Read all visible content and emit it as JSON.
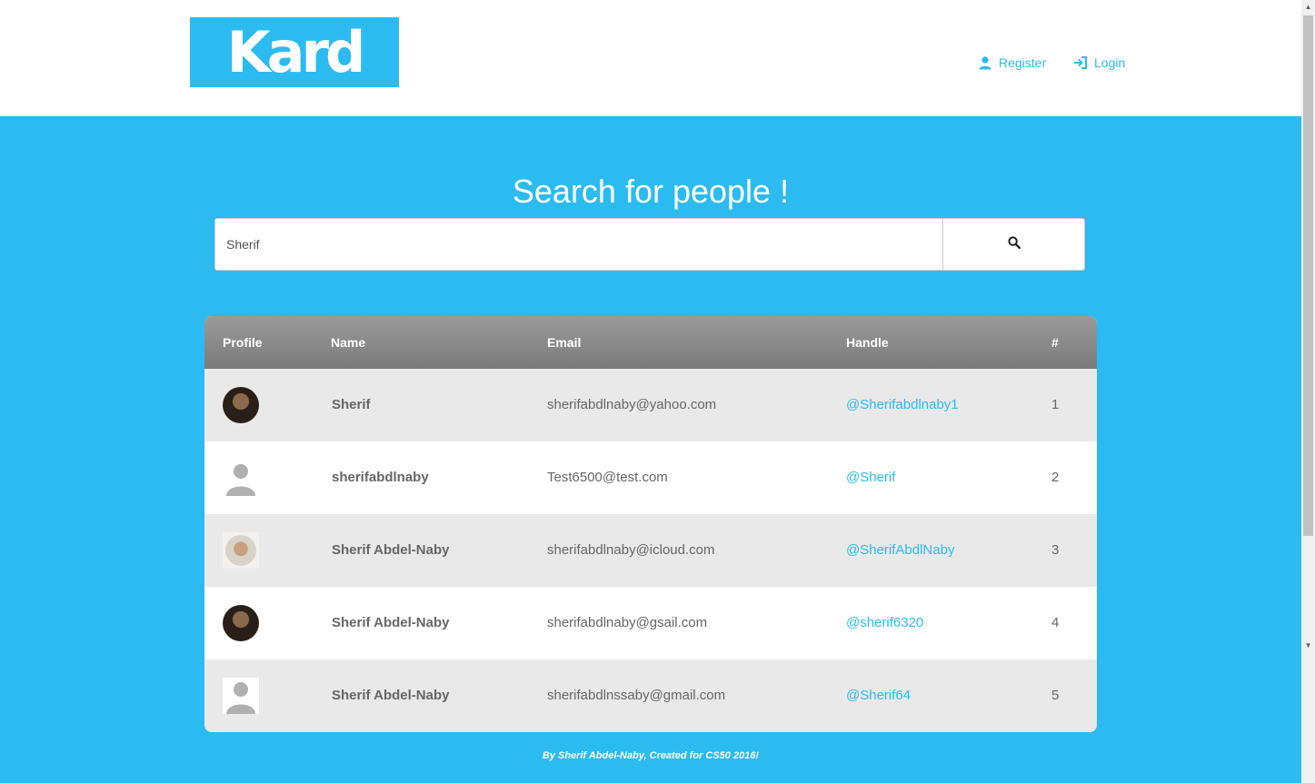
{
  "header": {
    "logo_text": "Kard",
    "nav": {
      "register_label": "Register",
      "login_label": "Login"
    }
  },
  "main": {
    "title": "Search for people !",
    "search": {
      "value": "Sherif",
      "button_icon": "search-icon"
    }
  },
  "table": {
    "headers": {
      "profile": "Profile",
      "name": "Name",
      "email": "Email",
      "handle": "Handle",
      "number": "#"
    },
    "rows": [
      {
        "avatar": "photo-dark",
        "name": "Sherif",
        "email": "sherifabdlnaby@yahoo.com",
        "handle": "@Sherifabdlnaby1",
        "number": "1"
      },
      {
        "avatar": "default",
        "name": "sherifabdlnaby",
        "email": "Test6500@test.com",
        "handle": "@Sherif",
        "number": "2"
      },
      {
        "avatar": "photo-light",
        "name": "Sherif Abdel-Naby",
        "email": "sherifabdlnaby@icloud.com",
        "handle": "@SherifAbdlNaby",
        "number": "3"
      },
      {
        "avatar": "photo-dark",
        "name": "Sherif Abdel-Naby",
        "email": "sherifabdlnaby@gsail.com",
        "handle": "@sherif6320",
        "number": "4"
      },
      {
        "avatar": "default",
        "name": "Sherif Abdel-Naby",
        "email": "sherifabdlnssaby@gmail.com",
        "handle": "@Sherif64",
        "number": "5"
      }
    ]
  },
  "footer": {
    "text": "By Sherif Abdel-Naby, Created for CS50 2016!"
  },
  "colors": {
    "brand": "#2bbbf1",
    "header_bg": "#ffffff",
    "table_head": "#8a8a8a"
  }
}
